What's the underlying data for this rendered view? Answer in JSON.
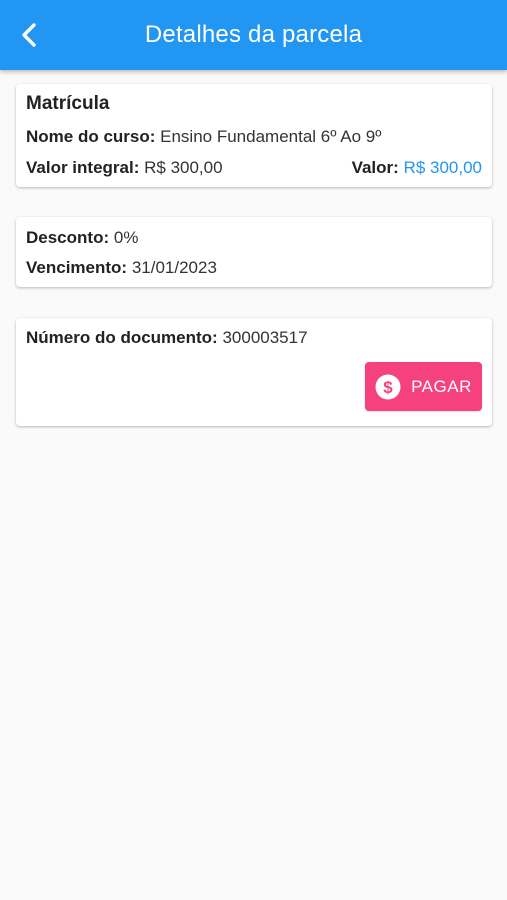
{
  "header": {
    "title": "Detalhes da parcela"
  },
  "enrollment": {
    "title": "Matrícula",
    "course_label": "Nome do curso:",
    "course_value": "Ensino Fundamental 6º Ao 9º",
    "full_value_label": "Valor integral:",
    "full_value": "R$ 300,00",
    "value_label": "Valor:",
    "value": "R$ 300,00"
  },
  "discount": {
    "discount_label": "Desconto:",
    "discount_value": "0%",
    "due_label": "Vencimento:",
    "due_value": "31/01/2023"
  },
  "document": {
    "number_label": "Número do documento:",
    "number_value": "300003517",
    "pay_label": "PAGAR",
    "pay_icon": "dollar-circle-icon"
  },
  "colors": {
    "appbar": "#2196f3",
    "accent": "#2196f3",
    "pay_button": "#f5427e"
  }
}
